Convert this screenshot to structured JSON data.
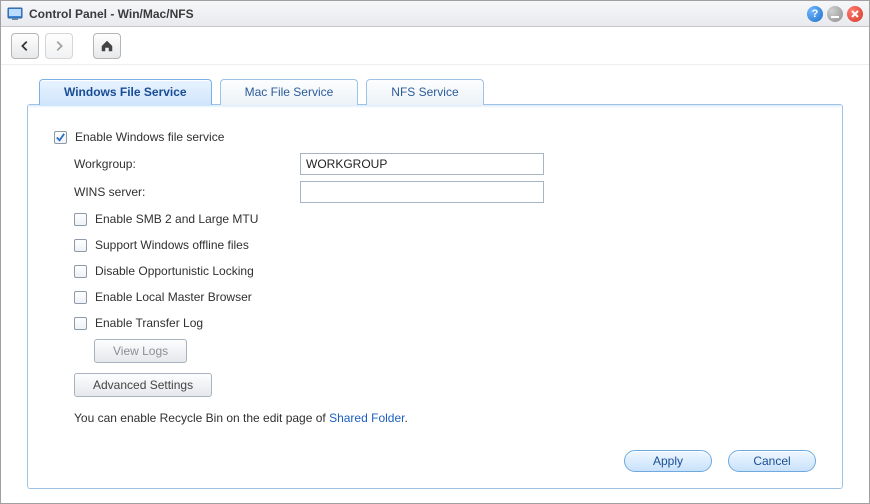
{
  "window": {
    "title": "Control Panel - Win/Mac/NFS"
  },
  "tabs": [
    {
      "label": "Windows File Service",
      "active": true
    },
    {
      "label": "Mac File Service",
      "active": false
    },
    {
      "label": "NFS Service",
      "active": false
    }
  ],
  "form": {
    "enable_windows_label": "Enable Windows file service",
    "enable_windows_checked": true,
    "workgroup_label": "Workgroup:",
    "workgroup_value": "WORKGROUP",
    "wins_label": "WINS server:",
    "wins_value": "",
    "smb2_label": "Enable SMB 2 and Large MTU",
    "smb2_checked": false,
    "offline_label": "Support Windows offline files",
    "offline_checked": false,
    "oplock_label": "Disable Opportunistic Locking",
    "oplock_checked": false,
    "master_browser_label": "Enable Local Master Browser",
    "master_browser_checked": false,
    "transfer_log_label": "Enable Transfer Log",
    "transfer_log_checked": false,
    "view_logs_label": "View Logs",
    "advanced_label": "Advanced Settings",
    "hint_prefix": "You can enable Recycle Bin on the edit page of ",
    "hint_link": "Shared Folder",
    "hint_suffix": "."
  },
  "buttons": {
    "apply": "Apply",
    "cancel": "Cancel"
  }
}
